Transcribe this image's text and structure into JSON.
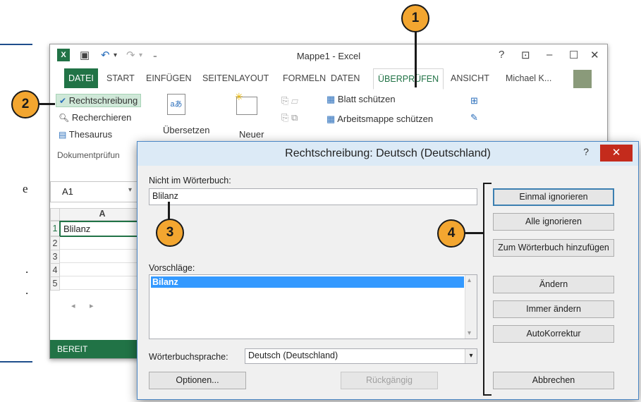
{
  "excel": {
    "title": "Mappe1 - Excel",
    "help": "?",
    "tabs": [
      "DATEI",
      "START",
      "EINFÜGEN",
      "SEITENLAYOUT",
      "FORMELN",
      "DATEN",
      "ÜBERPRÜFEN",
      "ANSICHT"
    ],
    "user": "Michael K...",
    "ribbon": {
      "spelling": "Rechtschreibung",
      "research": "Recherchieren",
      "thesaurus": "Thesaurus",
      "proofing_group": "Dokumentprüfun",
      "translate": "Übersetzen",
      "new_comment": "Neuer",
      "protect_sheet": "Blatt schützen",
      "protect_workbook": "Arbeitsmappe schützen"
    },
    "namebox": "A1",
    "col_header": "A",
    "rows": [
      "1",
      "2",
      "3",
      "4",
      "5"
    ],
    "cell_a1": "Blilanz",
    "status": "BEREIT"
  },
  "dialog": {
    "title": "Rechtschreibung: Deutsch (Deutschland)",
    "not_in_dict_label": "Nicht im Wörterbuch:",
    "not_in_dict_value": "Blilanz",
    "suggestions_label": "Vorschläge:",
    "suggestions": [
      "Bilanz"
    ],
    "language_label": "Wörterbuchsprache:",
    "language_value": "Deutsch (Deutschland)",
    "buttons": {
      "ignore_once": "Einmal ignorieren",
      "ignore_all": "Alle ignorieren",
      "add_to_dict": "Zum Wörterbuch hinzufügen",
      "change": "Ändern",
      "change_all": "Immer ändern",
      "autocorrect": "AutoKorrektur",
      "options": "Optionen...",
      "undo": "Rückgängig",
      "cancel": "Abbrechen"
    }
  },
  "callouts": [
    "1",
    "2",
    "3",
    "4"
  ],
  "side_text": [
    "e",
    ".",
    "."
  ],
  "colors": {
    "excel_green": "#217346",
    "callout": "#f3a630",
    "selection": "#3399ff",
    "close": "#c42b1c"
  }
}
